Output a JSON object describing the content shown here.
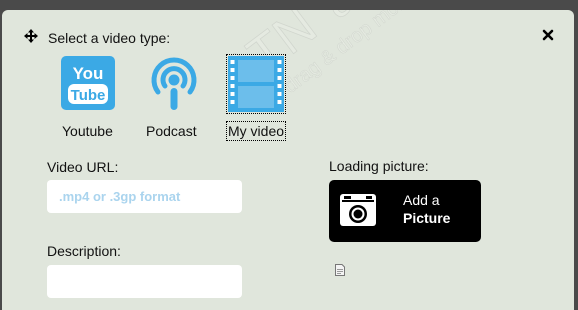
{
  "dialog": {
    "title": "Select a video type:"
  },
  "video_types": [
    {
      "label": "Youtube",
      "icon": "youtube-icon",
      "selected": false
    },
    {
      "label": "Podcast",
      "icon": "podcast-icon",
      "selected": false
    },
    {
      "label": "My video",
      "icon": "film-icon",
      "selected": true
    }
  ],
  "youtube_logo_text": {
    "line1": "You",
    "line2": "Tube"
  },
  "form": {
    "video_url_label": "Video URL:",
    "video_url_placeholder": ".mp4 or .3gp format",
    "description_label": "Description:",
    "loading_picture_label": "Loading picture:"
  },
  "add_picture": {
    "line1": "Add a",
    "line2": "Picture"
  },
  "watermark": {
    "brand_atn": "ATN",
    "brand_apps": "apps",
    "tagline": "drag & drop mobile app builder"
  },
  "colors": {
    "dialog_bg": "#e0e6dc",
    "icon_blue": "#3ba9e5",
    "button_bg": "#000000",
    "placeholder": "#aad4ee"
  }
}
